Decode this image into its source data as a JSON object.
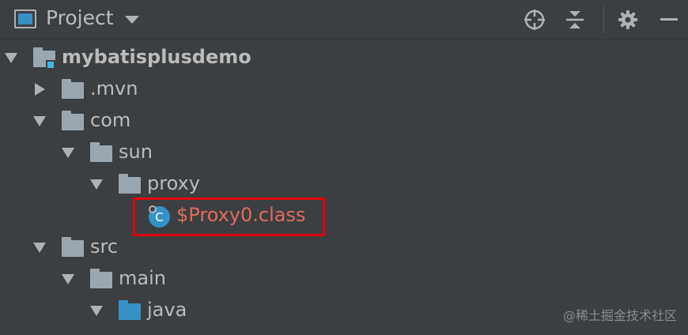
{
  "toolbar": {
    "view_icon": "project-view-icon",
    "title": "Project",
    "dropdown_icon": "triangle-down-icon",
    "actions": [
      {
        "icon": "locate-crosshair-icon"
      },
      {
        "icon": "collapse-all-icon"
      },
      {
        "icon": "gear-icon"
      },
      {
        "icon": "minimize-icon"
      }
    ]
  },
  "tree": {
    "nodes": [
      {
        "label": "mybatisplusdemo",
        "type": "module",
        "expanded": true
      },
      {
        "label": ".mvn",
        "type": "folder",
        "expanded": false
      },
      {
        "label": "com",
        "type": "folder",
        "expanded": true
      },
      {
        "label": "sun",
        "type": "folder",
        "expanded": true
      },
      {
        "label": "proxy",
        "type": "folder",
        "expanded": true
      },
      {
        "label": "$Proxy0.class",
        "type": "class-file",
        "icon_text": "C"
      },
      {
        "label": "src",
        "type": "folder",
        "expanded": true
      },
      {
        "label": "main",
        "type": "folder",
        "expanded": true
      },
      {
        "label": "java",
        "type": "source-folder",
        "expanded": true
      }
    ]
  },
  "colors": {
    "background": "#3c3f41",
    "text": "#bbbbbb",
    "error_text": "#e06c5f",
    "highlight": "#e1000f",
    "folder": "#9aa7b0",
    "source_folder": "#3592c4"
  },
  "watermark": "@稀土掘金技术社区"
}
